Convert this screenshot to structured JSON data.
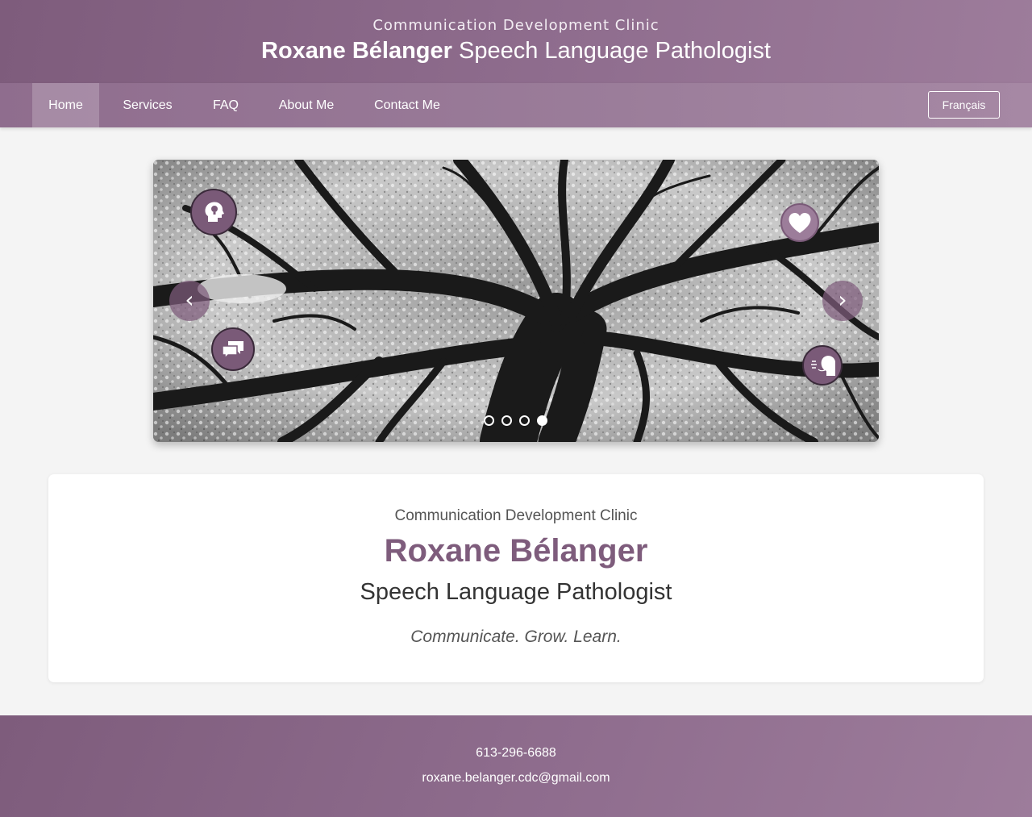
{
  "header": {
    "subtitle": "Communication Development Clinic",
    "name": "Roxane Bélanger",
    "profession": "Speech Language Pathologist"
  },
  "nav": {
    "items": [
      {
        "label": "Home",
        "active": true
      },
      {
        "label": "Services",
        "active": false
      },
      {
        "label": "FAQ",
        "active": false
      },
      {
        "label": "About Me",
        "active": false
      },
      {
        "label": "Contact Me",
        "active": false
      }
    ],
    "language_button": "Français"
  },
  "carousel": {
    "prev_label": "‹",
    "next_label": "›",
    "slide_count": 4,
    "active_slide": 4,
    "icons": [
      "head-lightbulb-icon",
      "heart-icon",
      "speech-bubbles-icon",
      "speaking-head-icon"
    ]
  },
  "intro": {
    "clinic": "Communication Development Clinic",
    "name": "Roxane Bélanger",
    "role": "Speech Language Pathologist",
    "tagline": "Communicate. Grow. Learn."
  },
  "footer": {
    "phone": "613-296-6688",
    "email": "roxane.belanger.cdc@gmail.com"
  },
  "colors": {
    "brand": "#7e5c7c",
    "brand_light": "#9d7c9b",
    "background": "#f4f4f4"
  }
}
